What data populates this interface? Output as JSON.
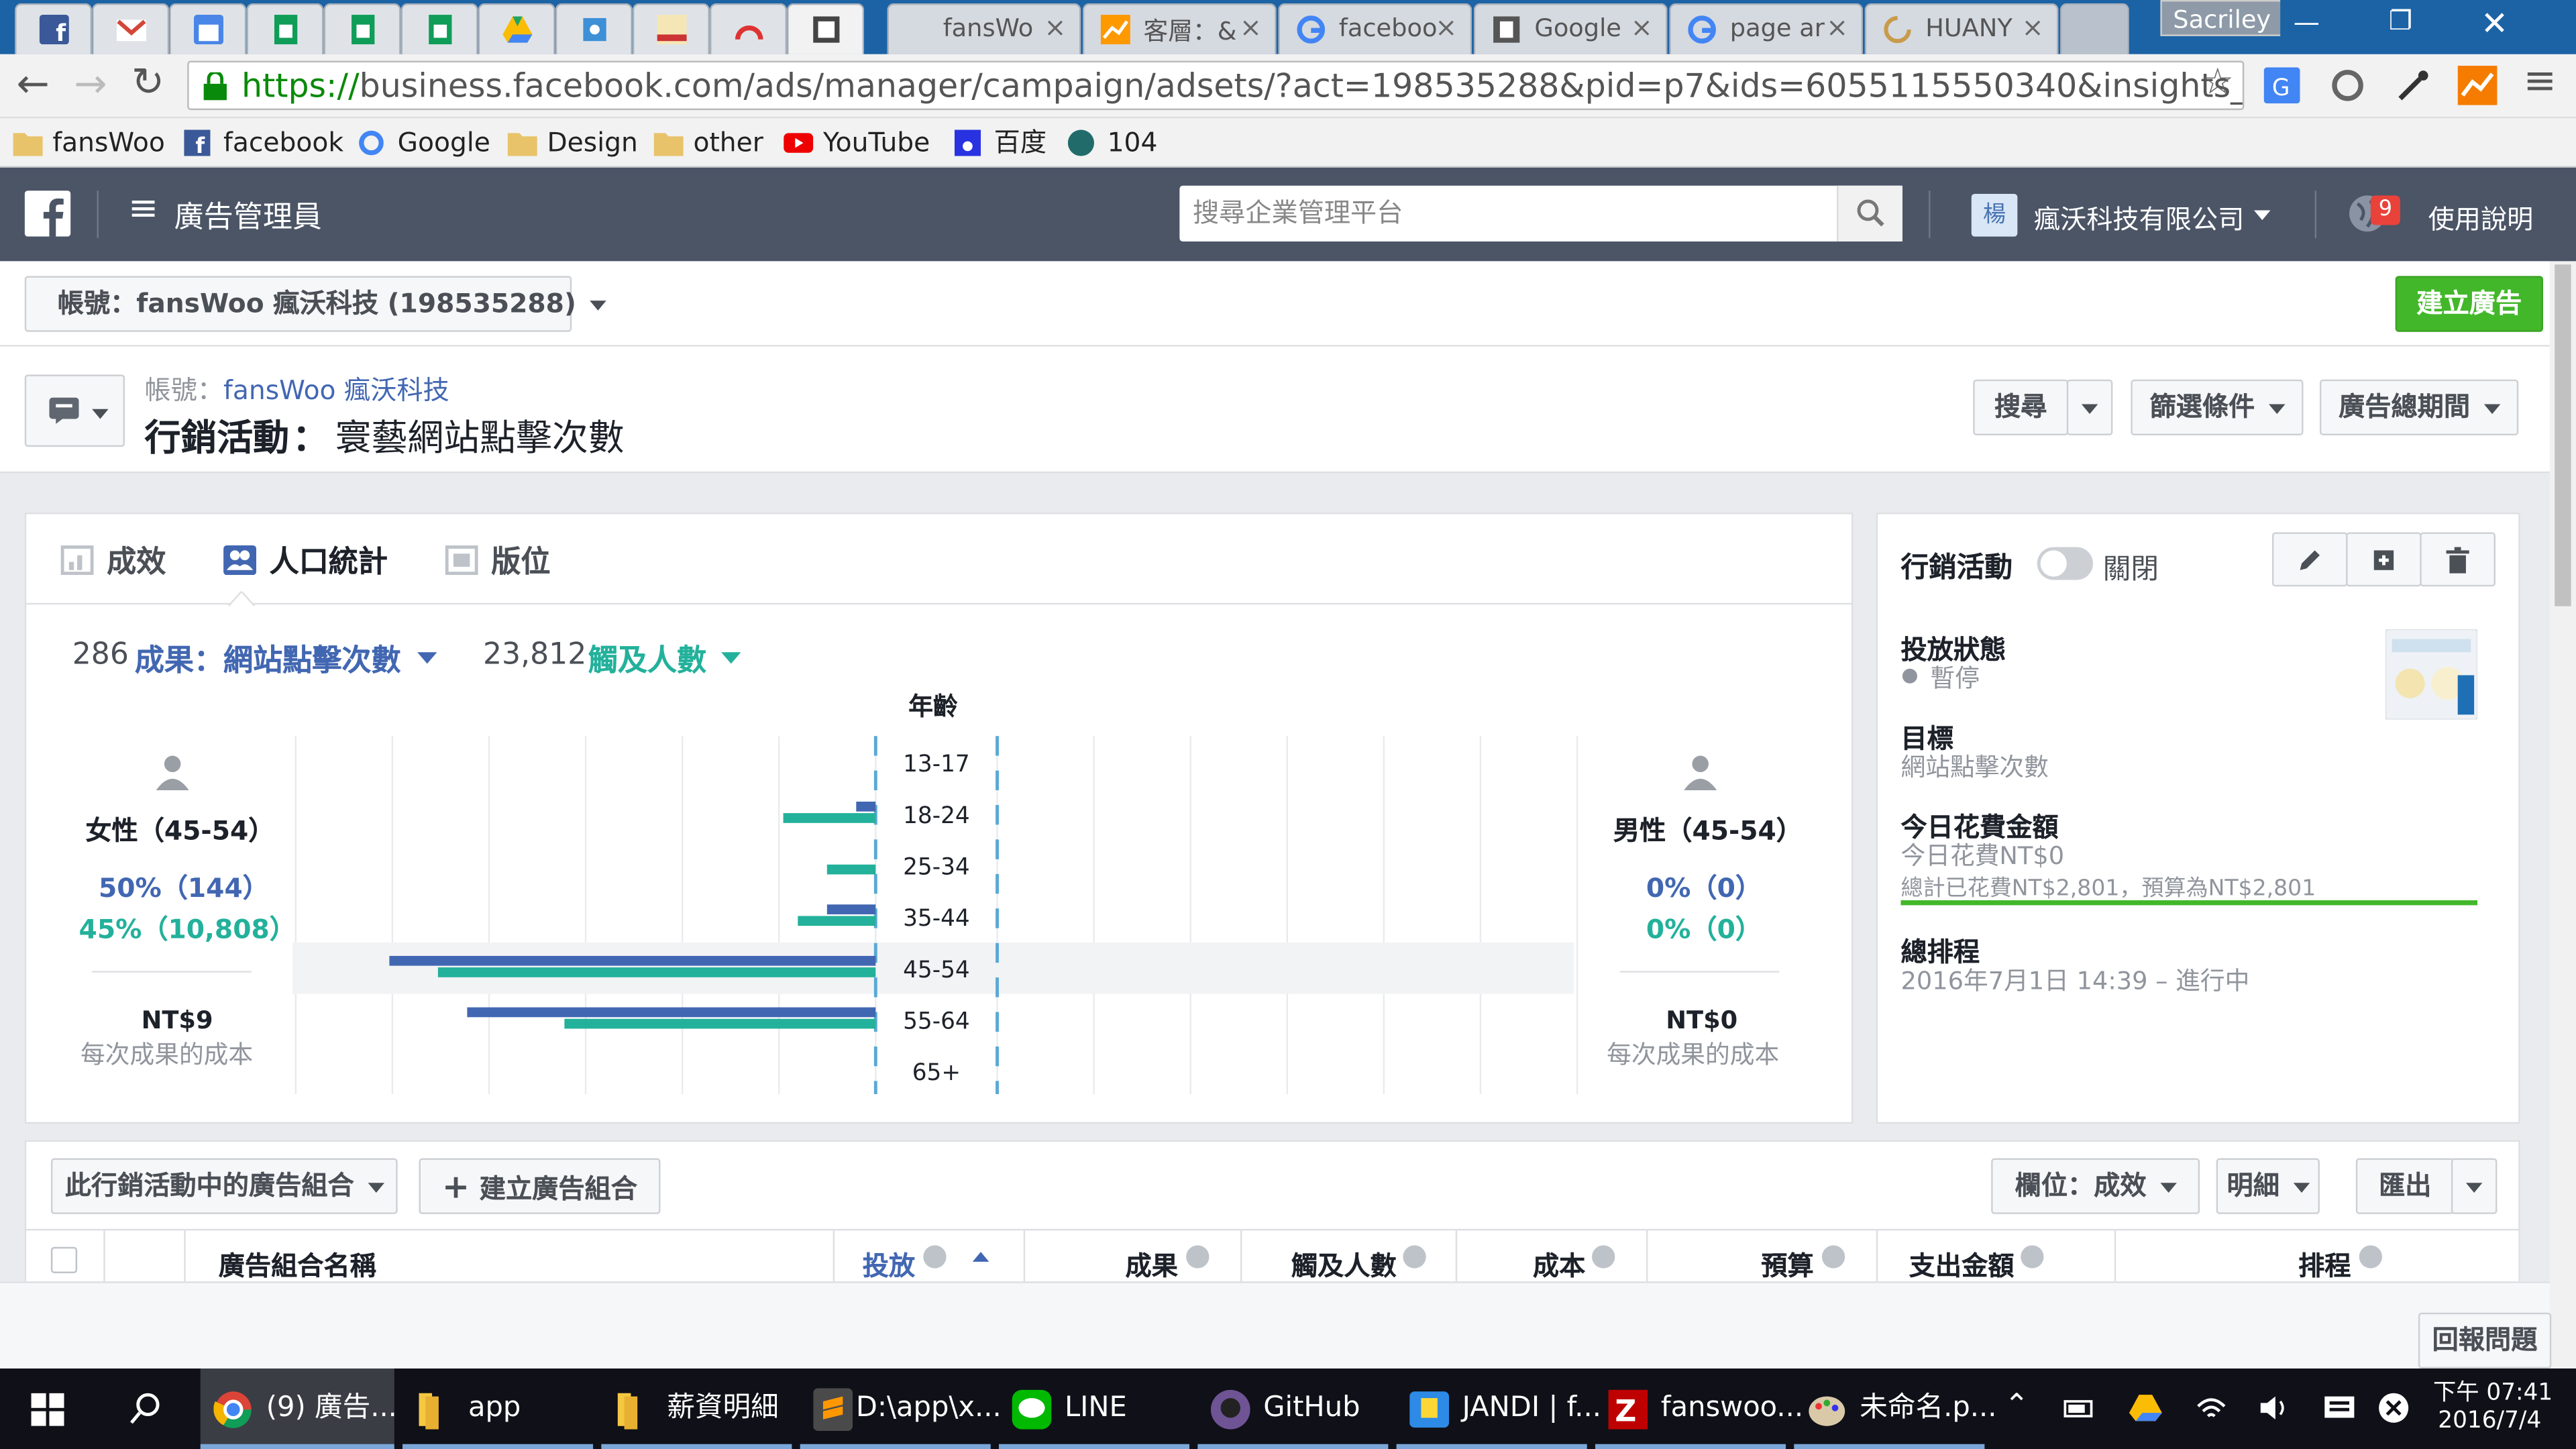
{
  "browser": {
    "tabs": [
      {
        "label": "fansWo",
        "icon": "document-icon"
      },
      {
        "label": "客層：&",
        "icon": "analytics-icon"
      },
      {
        "label": "faceboo",
        "icon": "google-icon"
      },
      {
        "label": "Google",
        "icon": "document-icon"
      },
      {
        "label": "page ar",
        "icon": "google-icon"
      },
      {
        "label": "HUANY",
        "icon": "loading-icon"
      }
    ],
    "user": "Sacriley",
    "url_scheme": "https://",
    "url_rest": "business.facebook.com/ads/manager/campaign/adsets/?act=198535288&pid=p7&ids=6055115550340&insights_sectior",
    "bookmarks": [
      "fansWoo",
      "facebook",
      "Google",
      "Design",
      "other",
      "YouTube",
      "百度",
      "104"
    ]
  },
  "fb": {
    "title": "廣告管理員",
    "search_placeholder": "搜尋企業管理平台",
    "company_initial": "楊",
    "company": "瘋沃科技有限公司",
    "notif_count": "9",
    "help": "使用說明"
  },
  "account_bar": {
    "account_label": "帳號：fansWoo 瘋沃科技 (198535288)",
    "create_ad": "建立廣告"
  },
  "header": {
    "breadcrumb_prefix": "帳號：",
    "breadcrumb_link": "fansWoo 瘋沃科技",
    "campaign_label": "行銷活動",
    "campaign_sep": "：",
    "campaign_name": "寰藝網站點擊次數",
    "search_btn": "搜尋",
    "filter_btn": "篩選條件",
    "period_btn": "廣告總期間"
  },
  "insights": {
    "tabs": [
      "成效",
      "人口統計",
      "版位"
    ],
    "results_count": "286",
    "results_label": "成果：網站點擊次數",
    "reach_count": "23,812",
    "reach_label": "觸及人數",
    "age_title": "年齡",
    "female": {
      "title": "女性（45-54）",
      "pct_results": "50%（144）",
      "pct_reach": "45%（10,808）",
      "cost": "NT$9",
      "cost_label": "每次成果的成本"
    },
    "male": {
      "title": "男性（45-54）",
      "pct_results": "0%（0）",
      "pct_reach": "0%（0）",
      "cost": "NT$0",
      "cost_label": "每次成果的成本"
    }
  },
  "chart_data": {
    "type": "bar",
    "categories": [
      "13-17",
      "18-24",
      "25-34",
      "35-44",
      "45-54",
      "55-64",
      "65+"
    ],
    "highlighted": "45-54",
    "series": [
      {
        "name": "成果：網站點擊次數",
        "color": "#4267b2",
        "female": [
          0,
          4,
          0,
          10,
          100,
          84,
          0
        ],
        "male": [
          0,
          0,
          0,
          0,
          0,
          0,
          0
        ]
      },
      {
        "name": "觸及人數",
        "color": "#23b19b",
        "female": [
          0,
          19,
          10,
          16,
          90,
          64,
          0
        ],
        "male": [
          0,
          0,
          0,
          0,
          0,
          0,
          0
        ]
      }
    ],
    "title": "年齡"
  },
  "side": {
    "campaign_label": "行銷活動",
    "toggle_label": "關閉",
    "status_title": "投放狀態",
    "status_value": "暫停",
    "goal_title": "目標",
    "goal_value": "網站點擊次數",
    "spend_title": "今日花費金額",
    "spend_today": "今日花費NT$0",
    "spend_total": "總計已花費NT$2,801，預算為NT$2,801",
    "spend_progress": 1.0,
    "schedule_title": "總排程",
    "schedule_value": "2016年7月1日 14:39 – 進行中"
  },
  "adsets": {
    "dropdown": "此行銷活動中的廣告組合",
    "create": "建立廣告組合",
    "columns_btn": "欄位：成效",
    "breakdown_btn": "明細",
    "export_btn": "匯出",
    "cols": [
      "廣告組合名稱",
      "投放",
      "成果",
      "觸及人數",
      "成本",
      "預算",
      "支出金額",
      "排程"
    ]
  },
  "feedback": "回報問題",
  "taskbar": {
    "items": [
      {
        "label": "(9) 廣告...",
        "icon": "chrome-icon"
      },
      {
        "label": "app",
        "icon": "folder-icon"
      },
      {
        "label": "薪資明細",
        "icon": "folder-icon"
      },
      {
        "label": "D:\\app\\x...",
        "icon": "sublime-icon"
      },
      {
        "label": "LINE",
        "icon": "line-icon"
      },
      {
        "label": "GitHub",
        "icon": "github-icon"
      },
      {
        "label": "JANDI | f...",
        "icon": "jandi-icon"
      },
      {
        "label": "fanswoo...",
        "icon": "filezilla-icon"
      },
      {
        "label": "未命名.p...",
        "icon": "paint-icon"
      }
    ],
    "time": "下午 07:41",
    "date": "2016/7/4"
  }
}
